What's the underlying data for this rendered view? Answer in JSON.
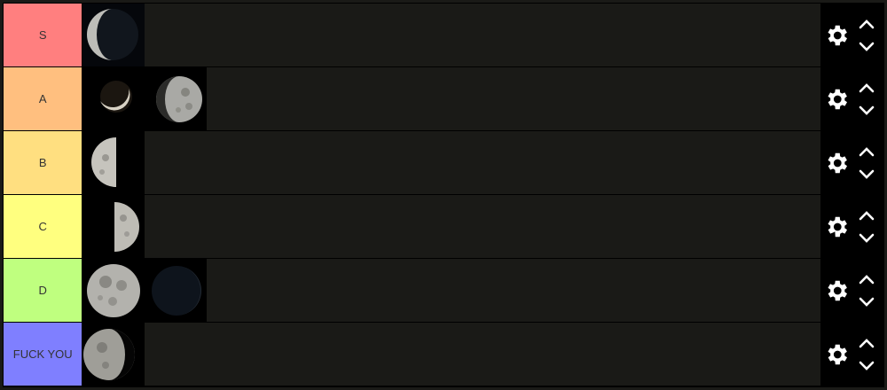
{
  "tiers": [
    {
      "label": "S",
      "color": "#ff7f7f",
      "items": [
        {
          "moon": "waning-crescent"
        }
      ]
    },
    {
      "label": "A",
      "color": "#ffbf7f",
      "items": [
        {
          "moon": "thin-crescent"
        },
        {
          "moon": "waning-gibbous"
        }
      ]
    },
    {
      "label": "B",
      "color": "#ffdf80",
      "items": [
        {
          "moon": "last-quarter"
        }
      ]
    },
    {
      "label": "C",
      "color": "#ffff7f",
      "items": [
        {
          "moon": "first-quarter"
        }
      ]
    },
    {
      "label": "D",
      "color": "#bfff7f",
      "items": [
        {
          "moon": "full-moon"
        },
        {
          "moon": "new-moon"
        }
      ]
    },
    {
      "label": "FUCK YOU",
      "color": "#7f7fff",
      "items": [
        {
          "moon": "gibbous"
        }
      ]
    }
  ],
  "controls": {
    "settings_icon": "gear-icon",
    "up_icon": "chevron-up-icon",
    "down_icon": "chevron-down-icon"
  }
}
